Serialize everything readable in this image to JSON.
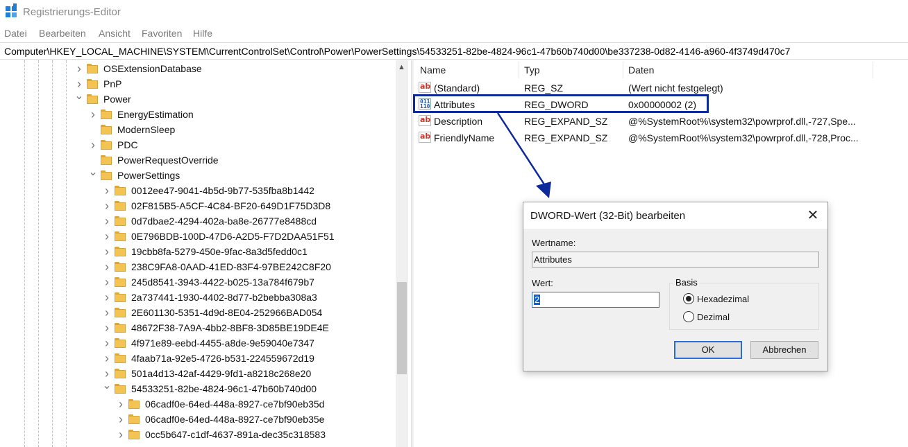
{
  "window": {
    "title": "Registrierungs-Editor",
    "icon": "regedit-icon"
  },
  "menu": [
    "Datei",
    "Bearbeiten",
    "Ansicht",
    "Favoriten",
    "Hilfe"
  ],
  "address": "Computer\\HKEY_LOCAL_MACHINE\\SYSTEM\\CurrentControlSet\\Control\\Power\\PowerSettings\\54533251-82be-4824-96c1-47b60b740d00\\be337238-0d82-4146-a960-4f3749d470c7",
  "tree": {
    "items": [
      {
        "label": "OSExtensionDatabase",
        "state": "collapsed"
      },
      {
        "label": "PnP",
        "state": "collapsed"
      },
      {
        "label": "Power",
        "state": "expanded"
      },
      {
        "label": "EnergyEstimation",
        "state": "collapsed"
      },
      {
        "label": "ModernSleep",
        "state": "none"
      },
      {
        "label": "PDC",
        "state": "collapsed"
      },
      {
        "label": "PowerRequestOverride",
        "state": "none"
      },
      {
        "label": "PowerSettings",
        "state": "expanded"
      },
      {
        "label": "0012ee47-9041-4b5d-9b77-535fba8b1442",
        "state": "collapsed"
      },
      {
        "label": "02F815B5-A5CF-4C84-BF20-649D1F75D3D8",
        "state": "collapsed"
      },
      {
        "label": "0d7dbae2-4294-402a-ba8e-26777e8488cd",
        "state": "collapsed"
      },
      {
        "label": "0E796BDB-100D-47D6-A2D5-F7D2DAA51F51",
        "state": "collapsed"
      },
      {
        "label": "19cbb8fa-5279-450e-9fac-8a3d5fedd0c1",
        "state": "collapsed"
      },
      {
        "label": "238C9FA8-0AAD-41ED-83F4-97BE242C8F20",
        "state": "collapsed"
      },
      {
        "label": "245d8541-3943-4422-b025-13a784f679b7",
        "state": "collapsed"
      },
      {
        "label": "2a737441-1930-4402-8d77-b2bebba308a3",
        "state": "collapsed"
      },
      {
        "label": "2E601130-5351-4d9d-8E04-252966BAD054",
        "state": "collapsed"
      },
      {
        "label": "48672F38-7A9A-4bb2-8BF8-3D85BE19DE4E",
        "state": "collapsed"
      },
      {
        "label": "4f971e89-eebd-4455-a8de-9e59040e7347",
        "state": "collapsed"
      },
      {
        "label": "4faab71a-92e5-4726-b531-224559672d19",
        "state": "collapsed"
      },
      {
        "label": "501a4d13-42af-4429-9fd1-a8218c268e20",
        "state": "collapsed"
      },
      {
        "label": "54533251-82be-4824-96c1-47b60b740d00",
        "state": "expanded"
      },
      {
        "label": "06cadf0e-64ed-448a-8927-ce7bf90eb35d",
        "state": "collapsed"
      },
      {
        "label": "06cadf0e-64ed-448a-8927-ce7bf90eb35e",
        "state": "collapsed"
      },
      {
        "label": "0cc5b647-c1df-4637-891a-dec35c318583",
        "state": "collapsed"
      }
    ]
  },
  "values": {
    "columns": [
      "Name",
      "Typ",
      "Daten"
    ],
    "rows": [
      {
        "name": "(Standard)",
        "type": "REG_SZ",
        "data": "(Wert nicht festgelegt)",
        "icon": "string-value-icon"
      },
      {
        "name": "Attributes",
        "type": "REG_DWORD",
        "data": "0x00000002 (2)",
        "icon": "binary-value-icon"
      },
      {
        "name": "Description",
        "type": "REG_EXPAND_SZ",
        "data": "@%SystemRoot%\\system32\\powrprof.dll,-727,Spe...",
        "icon": "string-value-icon"
      },
      {
        "name": "FriendlyName",
        "type": "REG_EXPAND_SZ",
        "data": "@%SystemRoot%\\system32\\powrprof.dll,-728,Proc...",
        "icon": "string-value-icon"
      }
    ],
    "highlight_color": "#0c2a9a"
  },
  "dialog": {
    "title": "DWORD-Wert (32-Bit) bearbeiten",
    "name_label": "Wertname:",
    "name_value": "Attributes",
    "value_label": "Wert:",
    "value_value": "2",
    "base_label": "Basis",
    "radio_hex": "Hexadezimal",
    "radio_dec": "Dezimal",
    "selected_base": "Hexadezimal",
    "ok_label": "OK",
    "cancel_label": "Abbrechen"
  }
}
